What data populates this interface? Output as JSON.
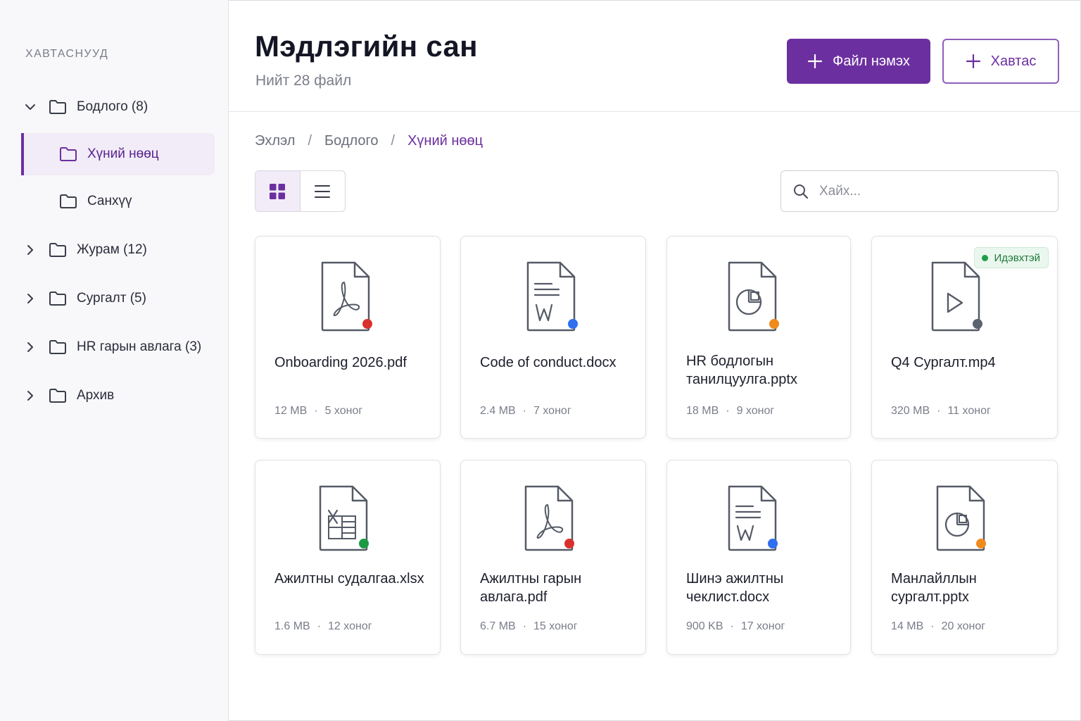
{
  "sidebar": {
    "heading": "ХАВТАСНУУД",
    "items": [
      {
        "label": "Бодлого (8)",
        "expanded": true
      },
      {
        "label": "Хүний нөөц",
        "active": true
      },
      {
        "label": "Санхүү"
      },
      {
        "label": "Журам (12)",
        "expanded": false
      },
      {
        "label": "Сургалт (5)",
        "expanded": false
      },
      {
        "label": "HR гарын авлага (3)",
        "expanded": false
      },
      {
        "label": "Архив",
        "expanded": false
      }
    ]
  },
  "header": {
    "title": "Мэдлэгийн сан",
    "subtitle": "Нийт 28 файл",
    "add_file_label": "Файл нэмэх",
    "add_folder_label": "Хавтас"
  },
  "breadcrumb": [
    "Эхлэл",
    "Бодлого",
    "Хүний нөөц"
  ],
  "search": {
    "placeholder": "Хайх..."
  },
  "view": {
    "mode": "grid"
  },
  "colors": {
    "accent": "#6c2fa0",
    "pdf": "#d8312d",
    "docx": "#2f6ff0",
    "pptx": "#f08a1c",
    "xlsx": "#1e9a45",
    "video": "#5d6270"
  },
  "files": [
    {
      "name": "Onboarding 2026.pdf",
      "size": "12 MB",
      "age": "5 хоног",
      "icon": "pdf-icon"
    },
    {
      "name": "Code of conduct.docx",
      "size": "2.4 MB",
      "age": "7 хоног",
      "icon": "word-icon"
    },
    {
      "name": "HR бодлогын танилцуулга.pptx",
      "size": "18 MB",
      "age": "9 хоног",
      "icon": "presentation-icon"
    },
    {
      "name": "Q4 Сургалт.mp4",
      "size": "320 MB",
      "age": "11 хоног",
      "icon": "video-icon",
      "badge": "Идэвхтэй"
    },
    {
      "name": "Ажилтны судалгаа.xlsx",
      "size": "1.6 MB",
      "age": "12 хоног",
      "icon": "excel-icon"
    },
    {
      "name": "Ажилтны гарын авлага.pdf",
      "size": "6.7 MB",
      "age": "15 хоног",
      "icon": "pdf-icon"
    },
    {
      "name": "Шинэ ажилтны чеклист.docx",
      "size": "900 KB",
      "age": "17 хоног",
      "icon": "word-icon"
    },
    {
      "name": "Манлайллын сургалт.pptx",
      "size": "14 MB",
      "age": "20 хоног",
      "icon": "presentation-icon"
    }
  ]
}
